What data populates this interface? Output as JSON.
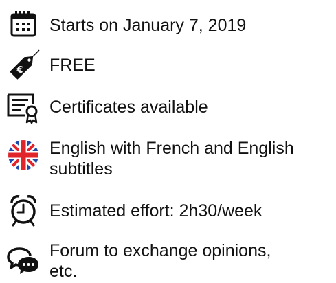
{
  "course_info": {
    "items": [
      {
        "icon": "calendar-icon",
        "label": "Starts on January 7, 2019"
      },
      {
        "icon": "price-tag-euro-icon",
        "label": "FREE"
      },
      {
        "icon": "certificate-icon",
        "label": "Certificates available"
      },
      {
        "icon": "uk-flag-icon",
        "label_line1": "English with French and English",
        "label_line2": "subtitles"
      },
      {
        "icon": "alarm-clock-icon",
        "label": "Estimated effort: 2h30/week"
      },
      {
        "icon": "forum-chat-icon",
        "label_line1": "Forum to exchange opinions,",
        "label_line2": "etc."
      }
    ]
  },
  "colors": {
    "text": "#111111",
    "icon": "#111111",
    "flag_blue": "#1f4aa8",
    "flag_red": "#e0262b",
    "flag_white": "#ffffff"
  }
}
